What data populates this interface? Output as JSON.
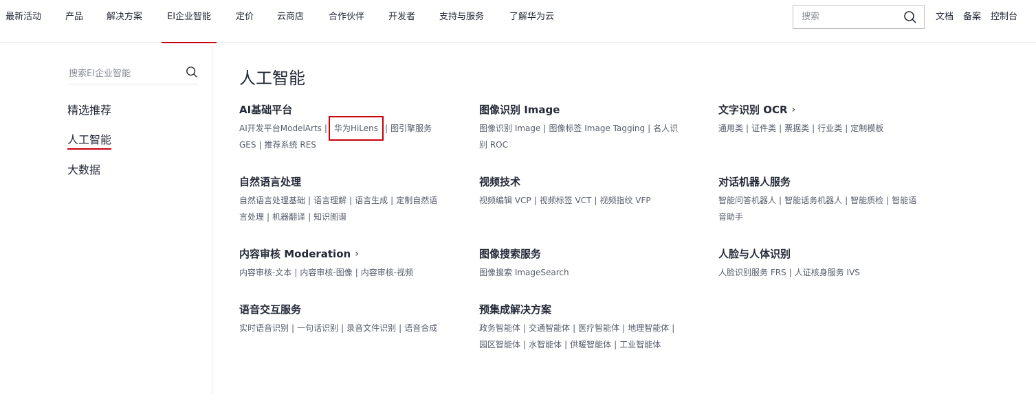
{
  "nav": {
    "items": [
      "最新活动",
      "产品",
      "解决方案",
      "EI企业智能",
      "定价",
      "云商店",
      "合作伙伴",
      "开发者",
      "支持与服务",
      "了解华为云"
    ],
    "active_index": 3,
    "search_placeholder": "搜索",
    "right_links": [
      "文档",
      "备案",
      "控制台"
    ]
  },
  "sidebar": {
    "search_placeholder": "搜索EI企业智能",
    "items": [
      "精选推荐",
      "人工智能",
      "大数据"
    ],
    "active_index": 1
  },
  "main": {
    "title": "人工智能",
    "categories": [
      {
        "title": "AI基础平台",
        "has_arrow": false,
        "links": [
          "AI开发平台ModelArts",
          "华为HiLens",
          "图引擎服务 GES",
          "推荐系统 RES"
        ]
      },
      {
        "title": "图像识别 Image",
        "has_arrow": false,
        "links": [
          "图像识别 Image",
          "图像标签 Image Tagging",
          "名人识别 ROC"
        ]
      },
      {
        "title": "文字识别 OCR",
        "has_arrow": true,
        "links": [
          "通用类",
          "证件类",
          "票据类",
          "行业类",
          "定制模板"
        ]
      },
      {
        "title": "自然语言处理",
        "has_arrow": false,
        "links": [
          "自然语言处理基础",
          "语言理解",
          "语言生成",
          "定制自然语言处理",
          "机器翻译",
          "知识图谱"
        ]
      },
      {
        "title": "视频技术",
        "has_arrow": false,
        "links": [
          "视频编辑 VCP",
          "视频标签 VCT",
          "视频指纹 VFP"
        ]
      },
      {
        "title": "对话机器人服务",
        "has_arrow": false,
        "links": [
          "智能问答机器人",
          "智能话务机器人",
          "智能质检",
          "智能语音助手"
        ]
      },
      {
        "title": "内容审核 Moderation",
        "has_arrow": true,
        "links": [
          "内容审核-文本",
          "内容审核-图像",
          "内容审核-视频"
        ]
      },
      {
        "title": "图像搜索服务",
        "has_arrow": false,
        "links": [
          "图像搜索 ImageSearch"
        ]
      },
      {
        "title": "人脸与人体识别",
        "has_arrow": false,
        "links": [
          "人脸识别服务 FRS",
          "人证核身服务 IVS"
        ]
      },
      {
        "title": "语音交互服务",
        "has_arrow": false,
        "links": [
          "实时语音识别",
          "一句话识别",
          "录音文件识别",
          "语音合成"
        ]
      },
      {
        "title": "预集成解决方案",
        "has_arrow": false,
        "links": [
          "政务智能体",
          "交通智能体",
          "医疗智能体",
          "地理智能体",
          "园区智能体",
          "水智能体",
          "供暖智能体",
          "工业智能体"
        ]
      }
    ],
    "highlighted_link": "华为HiLens",
    "arrow_glyph": "›"
  },
  "colors": {
    "accent": "#c7000b",
    "text": "#252b3a",
    "link": "#575d6c",
    "border": "#e4e4e4"
  }
}
